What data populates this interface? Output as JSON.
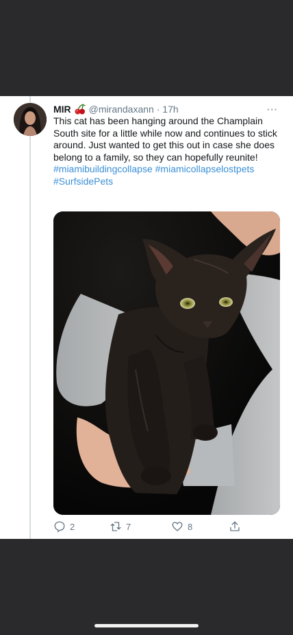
{
  "tweet": {
    "display_name": "MIR",
    "handle": "@mirandaxann",
    "separator": "·",
    "time": "17h",
    "text": "This cat has been hanging around the Champlain South site for a little while now and continues to stick around. Just wanted to get this out in case she does belong to a family, so they can hopefully reunite!",
    "hashtags": [
      "#miamibuildingcollapse",
      "#miamicollapselostpets",
      "#SurfsidePets"
    ],
    "replies": "2",
    "retweets": "7",
    "likes": "8"
  },
  "icons": {
    "name_emoji": "cherries-emoji",
    "more": "more-icon",
    "reply": "reply-icon",
    "retweet": "retweet-icon",
    "like": "like-icon",
    "share": "share-icon"
  },
  "colors": {
    "background": "#2a2a2c",
    "card": "#ffffff",
    "hashtag": "#3a8fd6",
    "secondary_text": "#657786"
  }
}
